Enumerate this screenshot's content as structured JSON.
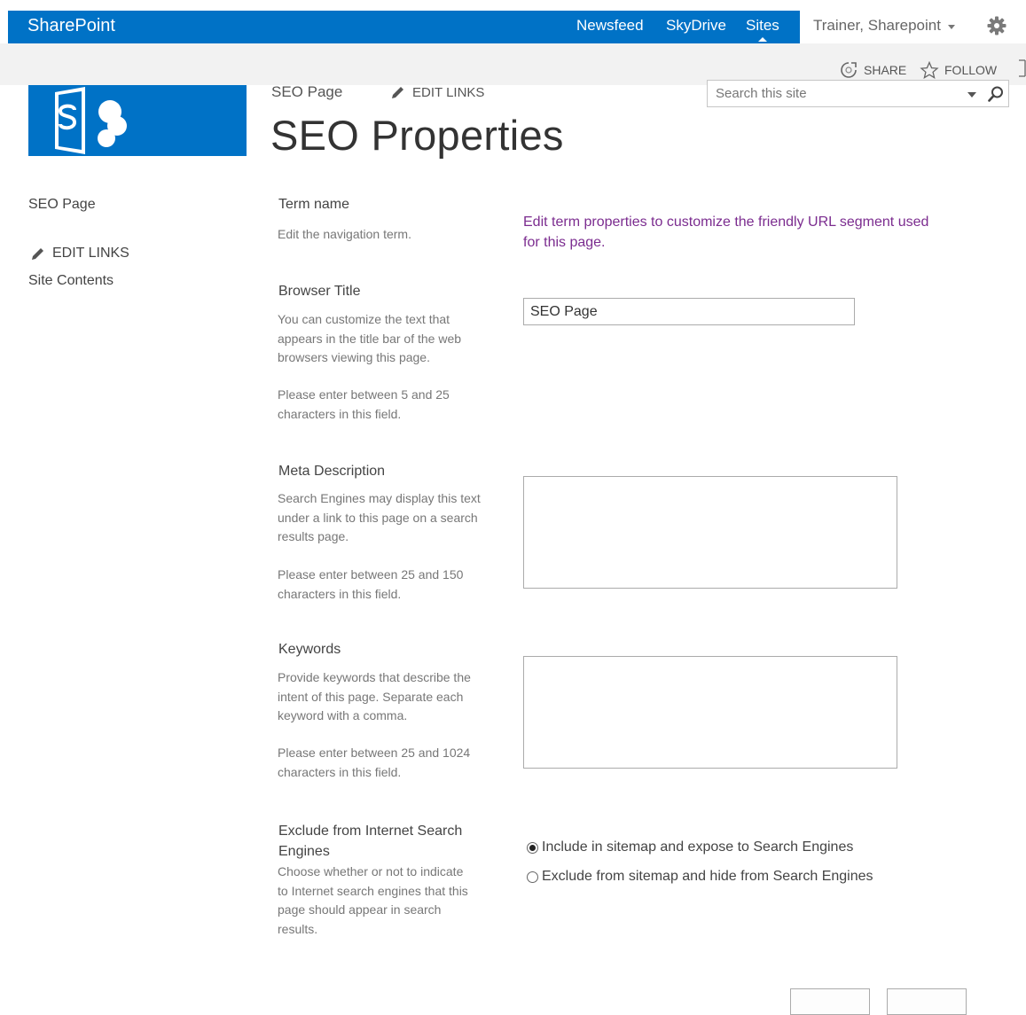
{
  "suite_bar": {
    "brand": "SharePoint",
    "links": [
      "Newsfeed",
      "SkyDrive",
      "Sites"
    ],
    "active_link": "Sites",
    "user": "Trainer, Sharepoint",
    "accent_color": "#0072c6"
  },
  "actions": {
    "share": "SHARE",
    "follow": "FOLLOW"
  },
  "top_nav": {
    "current": "SEO Page",
    "edit_links": "EDIT LINKS"
  },
  "page": {
    "title": "SEO Properties"
  },
  "search": {
    "placeholder": "Search this site"
  },
  "left_nav": {
    "items": [
      "SEO Page",
      "Site Contents"
    ],
    "edit_links": "EDIT LINKS"
  },
  "form": {
    "term_name": {
      "title": "Term name",
      "description": "Edit the navigation term.",
      "link": "Edit term properties to customize the friendly URL segment used for this page."
    },
    "browser_title": {
      "title": "Browser Title",
      "description": "You can customize the text that appears in the title bar of the web browsers viewing this page.",
      "hint": "Please enter between 5 and 25 characters in this field.",
      "value": "SEO Page"
    },
    "meta_description": {
      "title": "Meta Description",
      "description": "Search Engines may display this text under a link to this page on a search results page.",
      "hint": "Please enter between 25 and 150 characters in this field.",
      "value": ""
    },
    "keywords": {
      "title": "Keywords",
      "description": "Provide keywords that describe the intent of this page. Separate each keyword with a comma.",
      "hint": "Please enter between 25 and 1024 characters in this field.",
      "value": ""
    },
    "exclude": {
      "title": "Exclude from Internet Search Engines",
      "description": "Choose whether or not to indicate to Internet search engines that this page should appear in search results.",
      "options": [
        "Include in sitemap and expose to Search Engines",
        "Exclude from sitemap and hide from Search Engines"
      ],
      "selected_index": 0
    }
  }
}
